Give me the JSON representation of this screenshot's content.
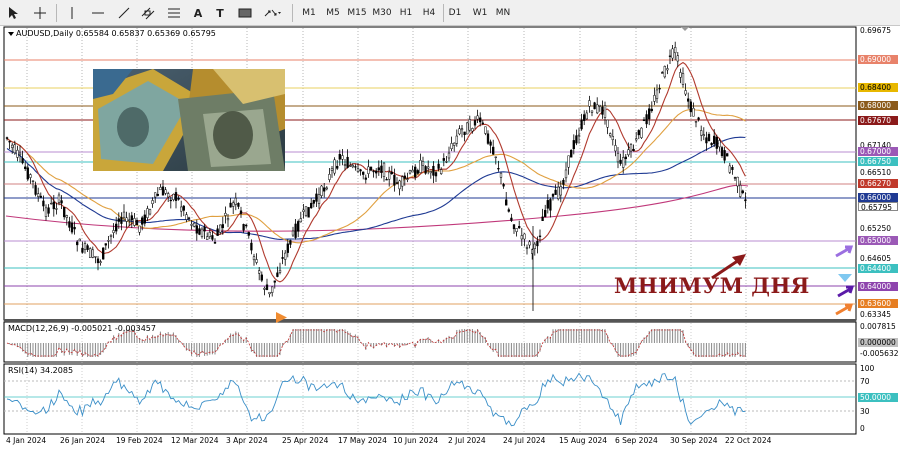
{
  "toolbar": {
    "tools": [
      {
        "name": "cursor",
        "label": "↖"
      },
      {
        "name": "crosshair",
        "label": "+"
      },
      {
        "name": "vertical-line",
        "label": "|"
      },
      {
        "name": "horizontal-line",
        "label": "—"
      },
      {
        "name": "trendline",
        "label": "/"
      },
      {
        "name": "channel",
        "label": "▦"
      },
      {
        "name": "fibonacci",
        "label": "F"
      },
      {
        "name": "text",
        "label": "A"
      },
      {
        "name": "label",
        "label": "T"
      },
      {
        "name": "shapes",
        "label": "⬚"
      }
    ],
    "timeframes": [
      "M1",
      "M5",
      "M15",
      "M30",
      "H1",
      "H4",
      "D1",
      "W1",
      "MN"
    ],
    "active_timeframe": "D1"
  },
  "chart": {
    "header": "AUDUSD,Daily  0.65584 0.65837 0.65369 0.65795",
    "annotation": "МНИМУМ ДНЯ",
    "current_price": "0.65795",
    "y_labels": [
      "0.69675",
      "0.67140",
      "0.66510",
      "0.65250",
      "0.64605",
      "0.63345"
    ],
    "levels": [
      {
        "value": "0.69000",
        "color": "#e8826a",
        "line": "#e8826a"
      },
      {
        "value": "0.68400",
        "color": "#e8b800",
        "line": "#e8d060"
      },
      {
        "value": "0.68000",
        "color": "#8b5a1a",
        "line": "#8b5a1a"
      },
      {
        "value": "0.67670",
        "color": "#8b1a1a",
        "line": "#8b1a1a"
      },
      {
        "value": "0.67000",
        "color": "#9b59b6",
        "line": "#b98cd0"
      },
      {
        "value": "0.66750",
        "color": "#3cc0c0",
        "line": "#3cc0c0"
      },
      {
        "value": "0.66270",
        "color": "#c0392b",
        "line": "#d08080"
      },
      {
        "value": "0.66000",
        "color": "#1f3a93",
        "line": "#1f3a93"
      },
      {
        "value": "0.65795",
        "color": "#ffffff",
        "line": "#888888"
      },
      {
        "value": "0.65000",
        "color": "#9b59b6",
        "line": "#b98cd0"
      },
      {
        "value": "0.64400",
        "color": "#3cc0c0",
        "line": "#3cc0c0"
      },
      {
        "value": "0.64000",
        "color": "#8e44ad",
        "line": "#8e44ad"
      },
      {
        "value": "0.63600",
        "color": "#e67e22",
        "line": "#e0a060"
      }
    ],
    "dates": [
      "4 Jan 2024",
      "26 Jan 2024",
      "19 Feb 2024",
      "12 Mar 2024",
      "3 Apr 2024",
      "25 Apr 2024",
      "17 May 2024",
      "10 Jun 2024",
      "2 Jul 2024",
      "24 Jul 2024",
      "15 Aug 2024",
      "6 Sep 2024",
      "30 Sep 2024",
      "22 Oct 2024"
    ]
  },
  "macd": {
    "header": "MACD(12,26,9) -0.005021 -0.003457",
    "y_labels": [
      "0.007815",
      "0.000000",
      "-0.005632"
    ]
  },
  "rsi": {
    "header": "RSI(14) 34.2085",
    "y_labels": [
      "100",
      "70",
      "50.0000",
      "30",
      "0"
    ]
  },
  "colors": {
    "candle": "#000000",
    "ma_fast": "#b03a2e",
    "ma_mid": "#e0a040",
    "ma_slow": "#1f3a93",
    "ma_long": "#c0387a",
    "rsi": "#3b8fc8",
    "annotation": "#8b1a1a"
  }
}
